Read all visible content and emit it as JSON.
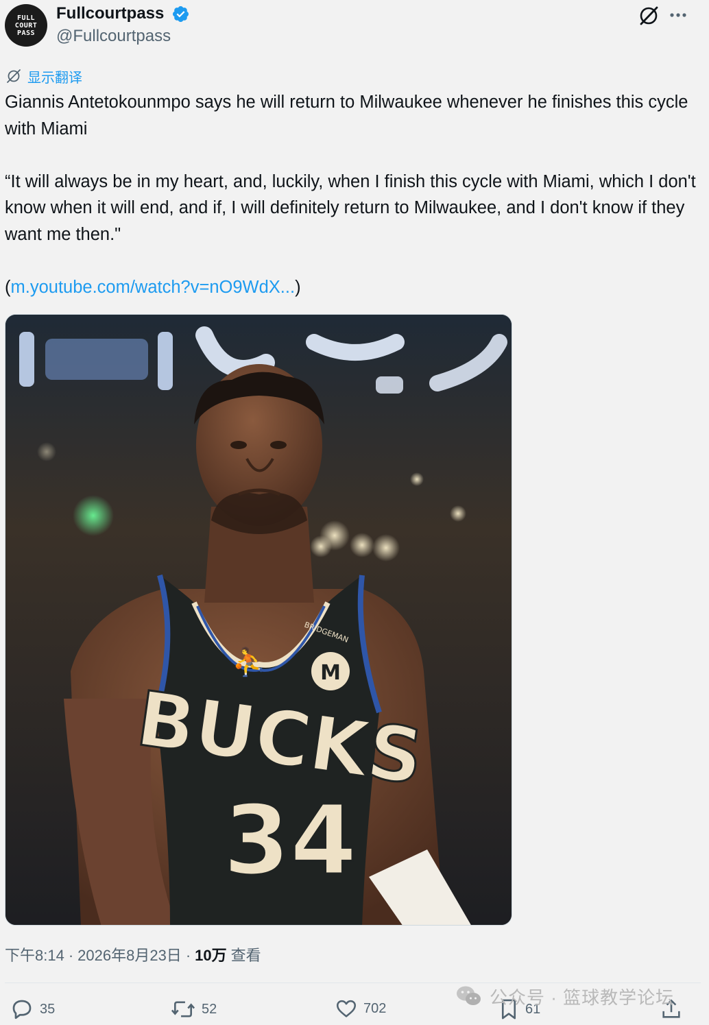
{
  "author": {
    "display_name": "Fullcourtpass",
    "handle": "@Fullcourtpass",
    "avatar_text": [
      "FULL",
      "COURT",
      "PASS"
    ],
    "verified": true
  },
  "translate_label": "显示翻译",
  "tweet": {
    "line1": "Giannis Antetokounmpo says he will return to Milwaukee whenever he finishes this cycle with Miami",
    "quote": "“It will always be in my heart, and, luckily, when I finish this cycle with Miami, which I don't know when it will end, and if, I will definitely return to Milwaukee, and I don't know if they want me then.\"",
    "link_open": "(",
    "link_text": "m.youtube.com/watch?v=nO9WdX...",
    "link_close": ")"
  },
  "media": {
    "jersey_team": "BUCKS",
    "jersey_number": "34",
    "patch_text": "BRIDGEMAN"
  },
  "meta": {
    "time": "下午8:14",
    "sep1": "·",
    "date": "2026年8月23日",
    "sep2": "·",
    "views_count": "10万",
    "views_label": "查看"
  },
  "actions": {
    "replies": "35",
    "reposts": "52",
    "likes": "702",
    "bookmarks": "61"
  },
  "watermark": {
    "text": "公众号 · 篮球教学论坛"
  },
  "colors": {
    "accent": "#1d9bf0",
    "secondary_text": "#536471",
    "primary_text": "#0f1419",
    "jersey": "#1f2322",
    "jersey_cream": "#eee1c6"
  },
  "icons": [
    "verified-badge-icon",
    "grok-icon",
    "more-icon",
    "translate-icon",
    "reply-icon",
    "repost-icon",
    "like-icon",
    "bookmark-icon",
    "share-icon",
    "wechat-icon"
  ]
}
